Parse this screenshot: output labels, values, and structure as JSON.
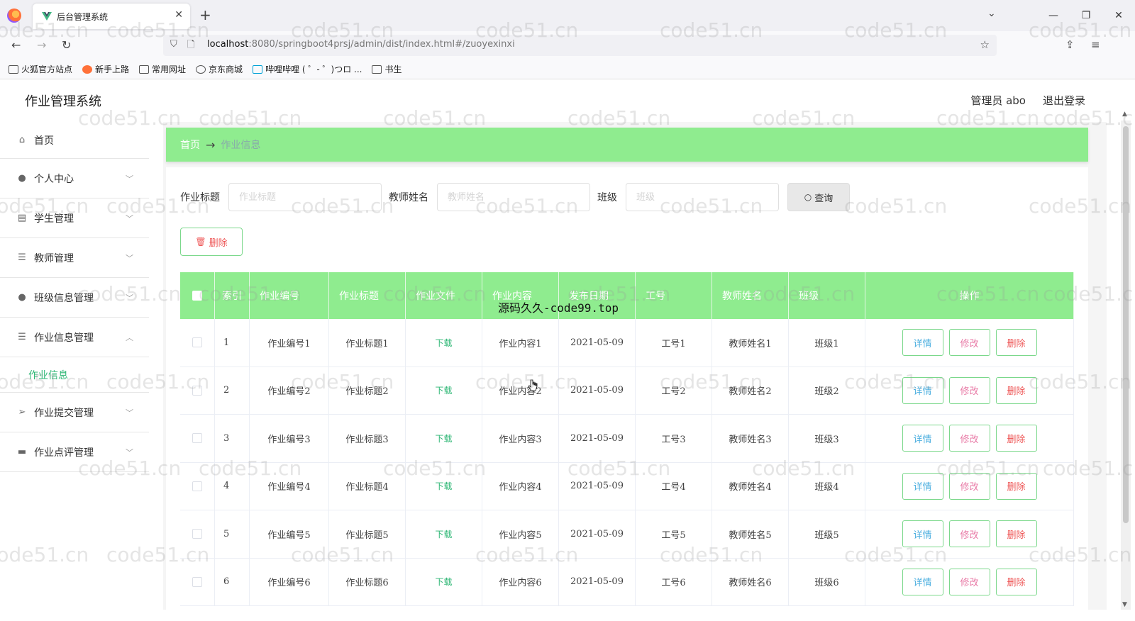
{
  "browser": {
    "tab_title": "后台管理系统",
    "url_host": "localhost",
    "url_rest": ":8080/springboot4prsj/admin/dist/index.html#/zuoyexinxi",
    "bookmarks": [
      "火狐官方站点",
      "新手上路",
      "常用网址",
      "京东商城",
      "哔哩哔哩 ( ゜- ゜)つロ ...",
      "书生"
    ]
  },
  "header": {
    "title": "作业管理系统",
    "user": "管理员 abo",
    "logout": "退出登录"
  },
  "sidebar": {
    "items": [
      {
        "label": "首页",
        "icon": "home-icon"
      },
      {
        "label": "个人中心",
        "icon": "user-icon"
      },
      {
        "label": "学生管理",
        "icon": "document-icon"
      },
      {
        "label": "教师管理",
        "icon": "sliders-icon"
      },
      {
        "label": "班级信息管理",
        "icon": "pin-icon"
      },
      {
        "label": "作业信息管理",
        "icon": "list-icon"
      },
      {
        "label": "作业提交管理",
        "icon": "send-icon"
      },
      {
        "label": "作业点评管理",
        "icon": "monitor-icon"
      }
    ],
    "submenu_active": "作业信息"
  },
  "breadcrumb": {
    "home": "首页",
    "current": "作业信息"
  },
  "search": {
    "title_label": "作业标题",
    "title_placeholder": "作业标题",
    "teacher_label": "教师姓名",
    "teacher_placeholder": "教师姓名",
    "class_label": "班级",
    "class_placeholder": "班级",
    "query_button": "查询"
  },
  "bulk_delete": "删除",
  "table": {
    "headers": [
      "索引",
      "作业编号",
      "作业标题",
      "作业文件",
      "作业内容",
      "发布日期",
      "工号",
      "教师姓名",
      "班级",
      "操作"
    ],
    "rows": [
      {
        "index": "1",
        "code": "作业编号1",
        "title": "作业标题1",
        "file": "下载",
        "content": "作业内容1",
        "date": "2021-05-09",
        "job_no": "工号1",
        "teacher": "教师姓名1",
        "class": "班级1"
      },
      {
        "index": "2",
        "code": "作业编号2",
        "title": "作业标题2",
        "file": "下载",
        "content": "作业内容2",
        "date": "2021-05-09",
        "job_no": "工号2",
        "teacher": "教师姓名2",
        "class": "班级2"
      },
      {
        "index": "3",
        "code": "作业编号3",
        "title": "作业标题3",
        "file": "下载",
        "content": "作业内容3",
        "date": "2021-05-09",
        "job_no": "工号3",
        "teacher": "教师姓名3",
        "class": "班级3"
      },
      {
        "index": "4",
        "code": "作业编号4",
        "title": "作业标题4",
        "file": "下载",
        "content": "作业内容4",
        "date": "2021-05-09",
        "job_no": "工号4",
        "teacher": "教师姓名4",
        "class": "班级4"
      },
      {
        "index": "5",
        "code": "作业编号5",
        "title": "作业标题5",
        "file": "下载",
        "content": "作业内容5",
        "date": "2021-05-09",
        "job_no": "工号5",
        "teacher": "教师姓名5",
        "class": "班级5"
      },
      {
        "index": "6",
        "code": "作业编号6",
        "title": "作业标题6",
        "file": "下载",
        "content": "作业内容6",
        "date": "2021-05-09",
        "job_no": "工号6",
        "teacher": "教师姓名6",
        "class": "班级6"
      }
    ],
    "actions": {
      "detail": "详情",
      "edit": "修改",
      "delete": "删除"
    }
  },
  "overlay_text": "源码久久-code99.top",
  "watermark": "code51.cn",
  "colors": {
    "accent": "#8fec8f",
    "link": "#2bb673",
    "danger": "#ee5555"
  }
}
